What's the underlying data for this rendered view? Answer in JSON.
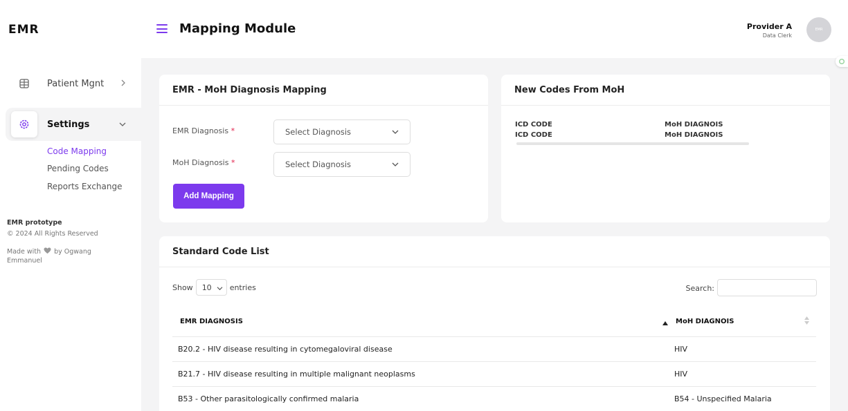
{
  "app": {
    "logo": "EMR"
  },
  "sidebar": {
    "items": [
      {
        "label": "Patient Mgnt",
        "icon": "grid-icon"
      },
      {
        "label": "Settings",
        "icon": "gear-icon"
      }
    ],
    "sub_items": [
      "Code Mapping",
      "Pending Codes",
      "Reports Exchange"
    ],
    "footer": {
      "name": "EMR prototype",
      "copyright": "© 2024 All Rights Reserved",
      "made_with_prefix": "Made with",
      "made_with_suffix": "by Ogwang",
      "author_last": "Emmanuel"
    }
  },
  "header": {
    "title": "Mapping Module",
    "user_name": "Provider A",
    "user_role": "Data Clerk",
    "avatar_text": "EMR"
  },
  "mapping_form": {
    "title": "EMR - MoH Diagnosis Mapping",
    "emr_label": "EMR Diagnosis",
    "moh_label": "MoH Diagnosis",
    "required_mark": "*",
    "emr_placeholder": "Select Diagnosis",
    "moh_placeholder": "Select Diagnosis",
    "submit_label": "Add Mapping"
  },
  "new_codes": {
    "title": "New Codes From MoH",
    "rows": [
      {
        "code": "ICD CODE",
        "diagnosis": "MoH DIAGNOIS"
      },
      {
        "code": "ICD CODE",
        "diagnosis": "MoH DIAGNOIS"
      }
    ]
  },
  "standard_list": {
    "title": "Standard Code List",
    "show_label": "Show",
    "entries_value": "10",
    "entries_label": "entries",
    "search_label": "Search:",
    "columns": [
      "EMR DIAGNOSIS",
      "MoH DIAGNOIS"
    ],
    "rows": [
      {
        "emr": "B20.2 - HIV disease resulting in cytomegaloviral disease",
        "moh": "HIV"
      },
      {
        "emr": "B21.7 - HIV disease resulting in multiple malignant neoplasms",
        "moh": "HIV"
      },
      {
        "emr": "B53 - Other parasitologically confirmed malaria",
        "moh": "B54 - Unspecified Malaria"
      }
    ]
  },
  "colors": {
    "accent": "#7c3aed",
    "background": "#f4f4f5"
  }
}
